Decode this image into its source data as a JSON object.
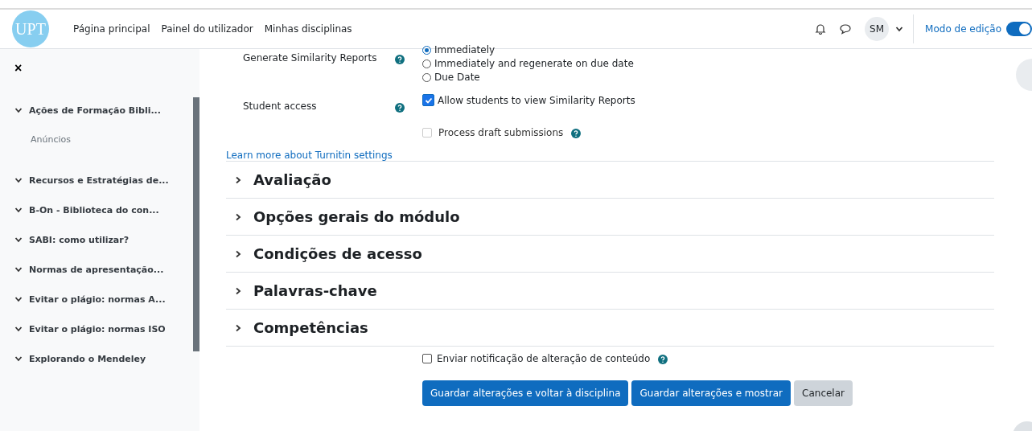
{
  "navbar": {
    "logo": "UPT",
    "links": [
      {
        "label": "Página principal"
      },
      {
        "label": "Painel do utilizador"
      },
      {
        "label": "Minhas disciplinas"
      }
    ],
    "avatar": "SM",
    "edit_mode": {
      "label": "Modo de edição",
      "on": true
    }
  },
  "sidebar": {
    "close": "×",
    "items": [
      {
        "label": "Ações de Formação Bibli...",
        "expanded": true,
        "children": [
          {
            "label": "Anúncios"
          }
        ]
      },
      {
        "label": "Recursos e Estratégias de...",
        "expanded": true
      },
      {
        "label": "B-On - Biblioteca do con...",
        "expanded": true
      },
      {
        "label": "SABI: como utilizar?",
        "expanded": true
      },
      {
        "label": "Normas de apresentação...",
        "expanded": true
      },
      {
        "label": "Evitar o plágio: normas A...",
        "expanded": true
      },
      {
        "label": "Evitar o plágio: normas ISO",
        "expanded": true
      },
      {
        "label": "Explorando o Mendeley",
        "expanded": true
      }
    ]
  },
  "form": {
    "rows": [
      {
        "label": "Generate Similarity Reports",
        "kind": "radio",
        "options": [
          {
            "label": "Immediately",
            "selected": true
          },
          {
            "label": "Immediately and regenerate on due date",
            "selected": false
          },
          {
            "label": "Due Date",
            "selected": false
          }
        ]
      },
      {
        "label": "Student access",
        "kind": "checkbox",
        "options": [
          {
            "label": "Allow students to view Similarity Reports",
            "checked": true,
            "disabled": false
          }
        ]
      },
      {
        "kind": "checkbox",
        "options": [
          {
            "label": "Process draft submissions",
            "checked": false,
            "disabled": true,
            "help": true
          }
        ]
      }
    ],
    "link": "Learn more about Turnitin settings",
    "sections": [
      {
        "title": "Avaliação",
        "expanded": false
      },
      {
        "title": "Opções gerais do módulo",
        "expanded": false
      },
      {
        "title": "Condições de acesso",
        "expanded": false
      },
      {
        "title": "Palavras-chave",
        "expanded": false
      },
      {
        "title": "Competências",
        "expanded": false
      }
    ],
    "notify": {
      "label": "Enviar notificação de alteração de conteúdo",
      "checked": false
    },
    "buttons": [
      {
        "label": "Guardar alterações e voltar à disciplina",
        "kind": "primary"
      },
      {
        "label": "Guardar alterações e mostrar",
        "kind": "primary"
      },
      {
        "label": "Cancelar",
        "kind": "secondary"
      }
    ]
  }
}
